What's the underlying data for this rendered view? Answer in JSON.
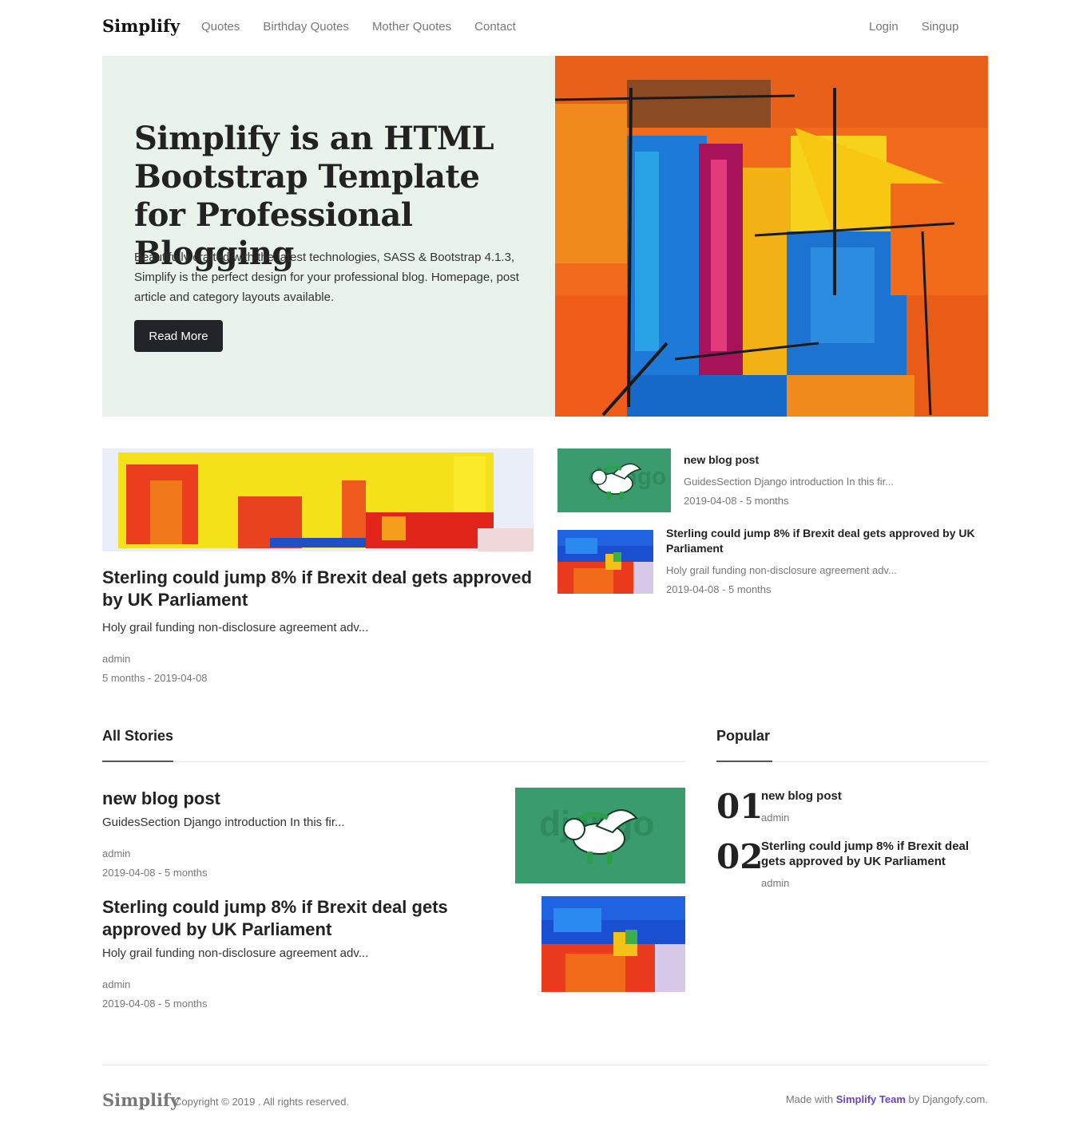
{
  "nav": {
    "brand": "Simplify",
    "links": [
      "Quotes",
      "Birthday Quotes",
      "Mother Quotes",
      "Contact"
    ],
    "right": [
      "Login",
      "Singup"
    ]
  },
  "hero": {
    "title": "Simplify is an HTML Bootstrap Template for Professional Blogging",
    "description": "Beautifully crafted with the latest technologies, SASS & Bootstrap 4.1.3, Simplify is the perfect design for your professional blog. Homepage, post article and category layouts available.",
    "button": "Read More",
    "colors": {
      "panel_bg": "#e9f3ec",
      "button_bg": "#212529"
    }
  },
  "featured": {
    "title": "Sterling could jump 8% if Brexit deal gets approved by UK Parliament",
    "excerpt": "Holy grail funding non-disclosure agreement adv...",
    "author": "admin",
    "date": "5 months - 2019-04-08"
  },
  "side_posts": [
    {
      "title": "new blog post",
      "excerpt": "GuidesSection Django introduction In this fir...",
      "date": "2019-04-08 - 5 months",
      "thumb": "django-pony"
    },
    {
      "title": "Sterling could jump 8% if Brexit deal gets approved by UK Parliament",
      "excerpt": "Holy grail funding non-disclosure agreement adv...",
      "date": "2019-04-08 - 5 months",
      "thumb": "paint"
    }
  ],
  "all_stories": {
    "heading": "All Stories",
    "items": [
      {
        "title": "new blog post",
        "excerpt": "GuidesSection Django introduction In this fir...",
        "author": "admin",
        "date": "2019-04-08 - 5 months",
        "thumb": "django-pony"
      },
      {
        "title": "Sterling could jump 8% if Brexit deal gets approved by UK Parliament",
        "excerpt": "Holy grail funding non-disclosure agreement adv...",
        "author": "admin",
        "date": "2019-04-08 - 5 months",
        "thumb": "paint"
      }
    ]
  },
  "popular": {
    "heading": "Popular",
    "items": [
      {
        "num": "01",
        "title": "new blog post",
        "author": "admin"
      },
      {
        "num": "02",
        "title": "Sterling could jump 8% if Brexit deal gets approved by UK Parliament",
        "author": "admin"
      }
    ]
  },
  "footer": {
    "brand": "Simplify",
    "copyright": "Copyright © 2019 . All rights reserved.",
    "made_prefix": "Made with",
    "team": "Simplify Team",
    "made_suffix": "by Djangofy.com.",
    "accent": "#6f42c1"
  }
}
